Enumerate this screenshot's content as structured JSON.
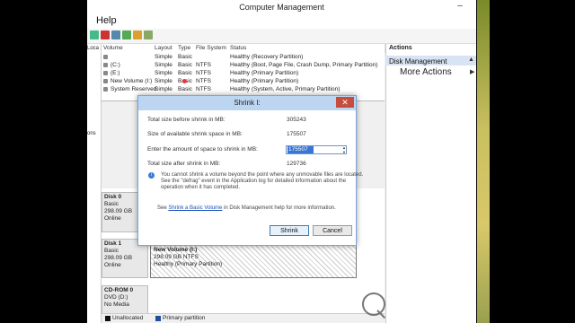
{
  "window": {
    "title": "Computer Management",
    "min_glyph": "–"
  },
  "menu": {
    "help": "Help"
  },
  "nav": {
    "items": [
      "Loca",
      "ons"
    ]
  },
  "volume_table": {
    "headers": [
      "Volume",
      "Layout",
      "Type",
      "File System",
      "Status"
    ],
    "rows": [
      {
        "volume": "",
        "layout": "Simple",
        "type": "Basic",
        "fs": "",
        "status": "Healthy (Recovery Partition)"
      },
      {
        "volume": "(C:)",
        "layout": "Simple",
        "type": "Basic",
        "fs": "NTFS",
        "status": "Healthy (Boot, Page File, Crash Dump, Primary Partition)"
      },
      {
        "volume": "(E:)",
        "layout": "Simple",
        "type": "Basic",
        "fs": "NTFS",
        "status": "Healthy (Primary Partition)"
      },
      {
        "volume": "New Volume (I:)",
        "layout": "Simple",
        "type": "Basic",
        "fs": "NTFS",
        "status": "Healthy (Primary Partition)"
      },
      {
        "volume": "System Reserved",
        "layout": "Simple",
        "type": "Basic",
        "fs": "NTFS",
        "status": "Healthy (System, Active, Primary Partition)"
      }
    ]
  },
  "disks": [
    {
      "name": "Disk 0",
      "type": "Basic",
      "size": "298.09 GB",
      "state": "Online"
    },
    {
      "name": "Disk 1",
      "type": "Basic",
      "size": "298.09 GB",
      "state": "Online"
    },
    {
      "name": "CD-ROM 0",
      "type": "DVD (D:)",
      "size": "",
      "state": "No Media"
    }
  ],
  "partition": {
    "name": "New Volume (I:)",
    "size": "298.09 GB NTFS",
    "status": "Healthy (Primary Partition)"
  },
  "legend": {
    "unallocated": "Unallocated",
    "primary": "Primary partition"
  },
  "actions": {
    "title": "Actions",
    "selected": "Disk Management",
    "more": "More Actions"
  },
  "dialog": {
    "title": "Shrink I:",
    "close": "✕",
    "label_total": "Total size before shrink in MB:",
    "value_total": "305243",
    "label_available": "Size of available shrink space in MB:",
    "value_available": "175507",
    "label_enter": "Enter the amount of space to shrink in MB:",
    "input_value": "175507",
    "label_after": "Total size after shrink in MB:",
    "value_after": "129736",
    "note1": "You cannot shrink a volume beyond the point where any unmovable files are located.",
    "note2": "See the \"defrag\" event in the Application log for detailed information about the",
    "note3": "operation when it has completed.",
    "help_pre": "See",
    "help_link": "Shrink a Basic Volume",
    "help_post": "in Disk Management help for more information.",
    "shrink": "Shrink",
    "cancel": "Cancel"
  },
  "colors": {
    "accent": "#3875d7",
    "primary_partition": "#1f4e9a",
    "close_red": "#c74c3c"
  }
}
